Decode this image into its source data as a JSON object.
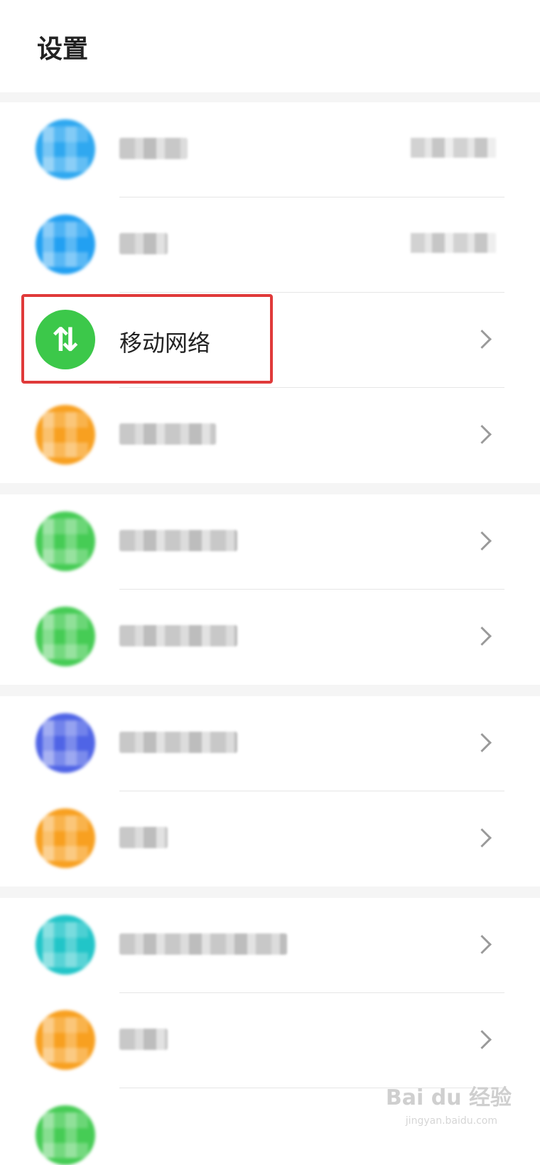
{
  "header": {
    "title": "设置"
  },
  "rows": [
    {
      "id": "row-1",
      "label": null,
      "color": "#2fa8f0",
      "blurred": true,
      "has_value": true
    },
    {
      "id": "row-2",
      "label": null,
      "color": "#22a0f2",
      "blurred": true,
      "has_value": true
    },
    {
      "id": "mobile-network",
      "label": "移动网络",
      "color": "#3cc84a",
      "blurred": false,
      "highlighted": true,
      "icon": "arrows-up-down-icon"
    },
    {
      "id": "row-4",
      "label": null,
      "color": "#f8a020",
      "blurred": true
    },
    {
      "id": "row-5",
      "label": null,
      "color": "#46cc55",
      "blurred": true
    },
    {
      "id": "row-6",
      "label": null,
      "color": "#46cc55",
      "blurred": true
    },
    {
      "id": "row-7",
      "label": null,
      "color": "#4f64e6",
      "blurred": true
    },
    {
      "id": "row-8",
      "label": null,
      "color": "#f8a020",
      "blurred": true
    },
    {
      "id": "row-9",
      "label": null,
      "color": "#21c5c8",
      "blurred": true
    },
    {
      "id": "row-10",
      "label": null,
      "color": "#f8a020",
      "blurred": true
    }
  ],
  "watermark": {
    "text": "Bai du 经验",
    "sub": "jingyan.baidu.com"
  }
}
